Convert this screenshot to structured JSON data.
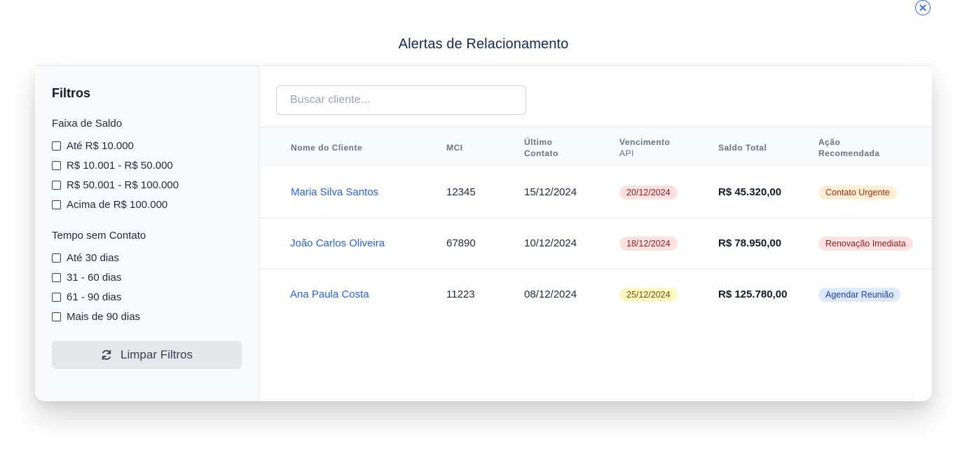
{
  "title": "Alertas de Relacionamento",
  "close_icon": "close-circle-icon",
  "sidebar": {
    "title": "Filtros",
    "saldo_group": {
      "title": "Faixa de Saldo",
      "options": [
        "Até R$ 10.000",
        "R$ 10.001 - R$ 50.000",
        "R$ 50.001 - R$ 100.000",
        "Acima de R$ 100.000"
      ]
    },
    "contato_group": {
      "title": "Tempo sem Contato",
      "options": [
        "Até 30 dias",
        "31 - 60 dias",
        "61 - 90 dias",
        "Mais de 90 dias"
      ]
    },
    "clear_button": {
      "label": "Limpar Filtros",
      "icon": "refresh-icon"
    }
  },
  "search": {
    "placeholder": "Buscar cliente...",
    "value": ""
  },
  "table": {
    "headers": {
      "cliente": "Nome do Cliente",
      "mci": "MCI",
      "ultimo_1": "Último",
      "ultimo_2": "Contato",
      "venc_1": "Vencimento",
      "venc_2": "API",
      "saldo": "Saldo Total",
      "acao_1": "Ação",
      "acao_2": "Recomendada"
    },
    "rows": [
      {
        "cliente": "Maria Silva Santos",
        "mci": "12345",
        "ultimo_contato": "15/12/2024",
        "vencimento": "20/12/2024",
        "vencimento_status": "red",
        "saldo": "R$ 45.320,00",
        "acao": "Contato Urgente",
        "acao_status": "orange"
      },
      {
        "cliente": "João Carlos Oliveira",
        "mci": "67890",
        "ultimo_contato": "10/12/2024",
        "vencimento": "18/12/2024",
        "vencimento_status": "red",
        "saldo": "R$ 78.950,00",
        "acao": "Renovação Imediata",
        "acao_status": "red"
      },
      {
        "cliente": "Ana Paula Costa",
        "mci": "11223",
        "ultimo_contato": "08/12/2024",
        "vencimento": "25/12/2024",
        "vencimento_status": "yellow",
        "saldo": "R$ 125.780,00",
        "acao": "Agendar Reunião",
        "acao_status": "blue"
      }
    ]
  },
  "colors": {
    "accent": "#2563eb",
    "title": "#0f2a5a",
    "badge_red_bg": "#fee2e2",
    "badge_yellow_bg": "#fef9c3",
    "badge_orange_bg": "#ffedd5",
    "badge_blue_bg": "#dbeafe"
  }
}
